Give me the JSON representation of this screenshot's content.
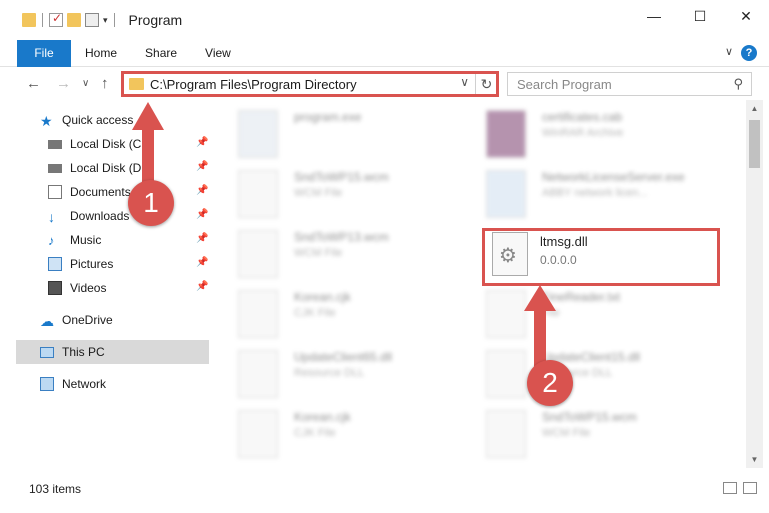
{
  "window": {
    "title": "Program"
  },
  "ribbon": {
    "file": "File",
    "tabs": [
      "Home",
      "Share",
      "View"
    ],
    "help": "?"
  },
  "nav": {
    "address": "C:\\Program Files\\Program Directory",
    "search_placeholder": "Search Program"
  },
  "sidebar": {
    "items": [
      {
        "label": "Quick access"
      },
      {
        "label": "Local Disk (C:)"
      },
      {
        "label": "Local Disk (D:)"
      },
      {
        "label": "Documents"
      },
      {
        "label": "Downloads"
      },
      {
        "label": "Music"
      },
      {
        "label": "Pictures"
      },
      {
        "label": "Videos"
      },
      {
        "label": "OneDrive"
      },
      {
        "label": "This PC"
      },
      {
        "label": "Network"
      }
    ]
  },
  "files": [
    {
      "name": "program.exe",
      "type": ""
    },
    {
      "name": "certificates.cab",
      "type": "WinRAR Archive"
    },
    {
      "name": "SndToWP15.wcm",
      "type": "WCM File"
    },
    {
      "name": "NetworkLicenseServer.exe",
      "type": "ABBY network licen..."
    },
    {
      "name": "SndToWP13.wcm",
      "type": "WCM File"
    },
    {
      "name": "Korean.cjk",
      "type": "CJK File"
    },
    {
      "name": "FineReader.txt",
      "type": "File"
    },
    {
      "name": "UpdateClient65.dll",
      "type": "Resource DLL"
    },
    {
      "name": "UpdateClient15.dll",
      "type": "Resource DLL"
    },
    {
      "name": "Korean.cjk",
      "type": "CJK File"
    },
    {
      "name": "SndToWP15.wcm",
      "type": "WCM File"
    }
  ],
  "highlighted_file": {
    "name": "ltmsg.dll",
    "version": "0.0.0.0"
  },
  "annotations": {
    "step1": "1",
    "step2": "2",
    "color": "#d9534f"
  },
  "status": {
    "count": "103 items"
  }
}
